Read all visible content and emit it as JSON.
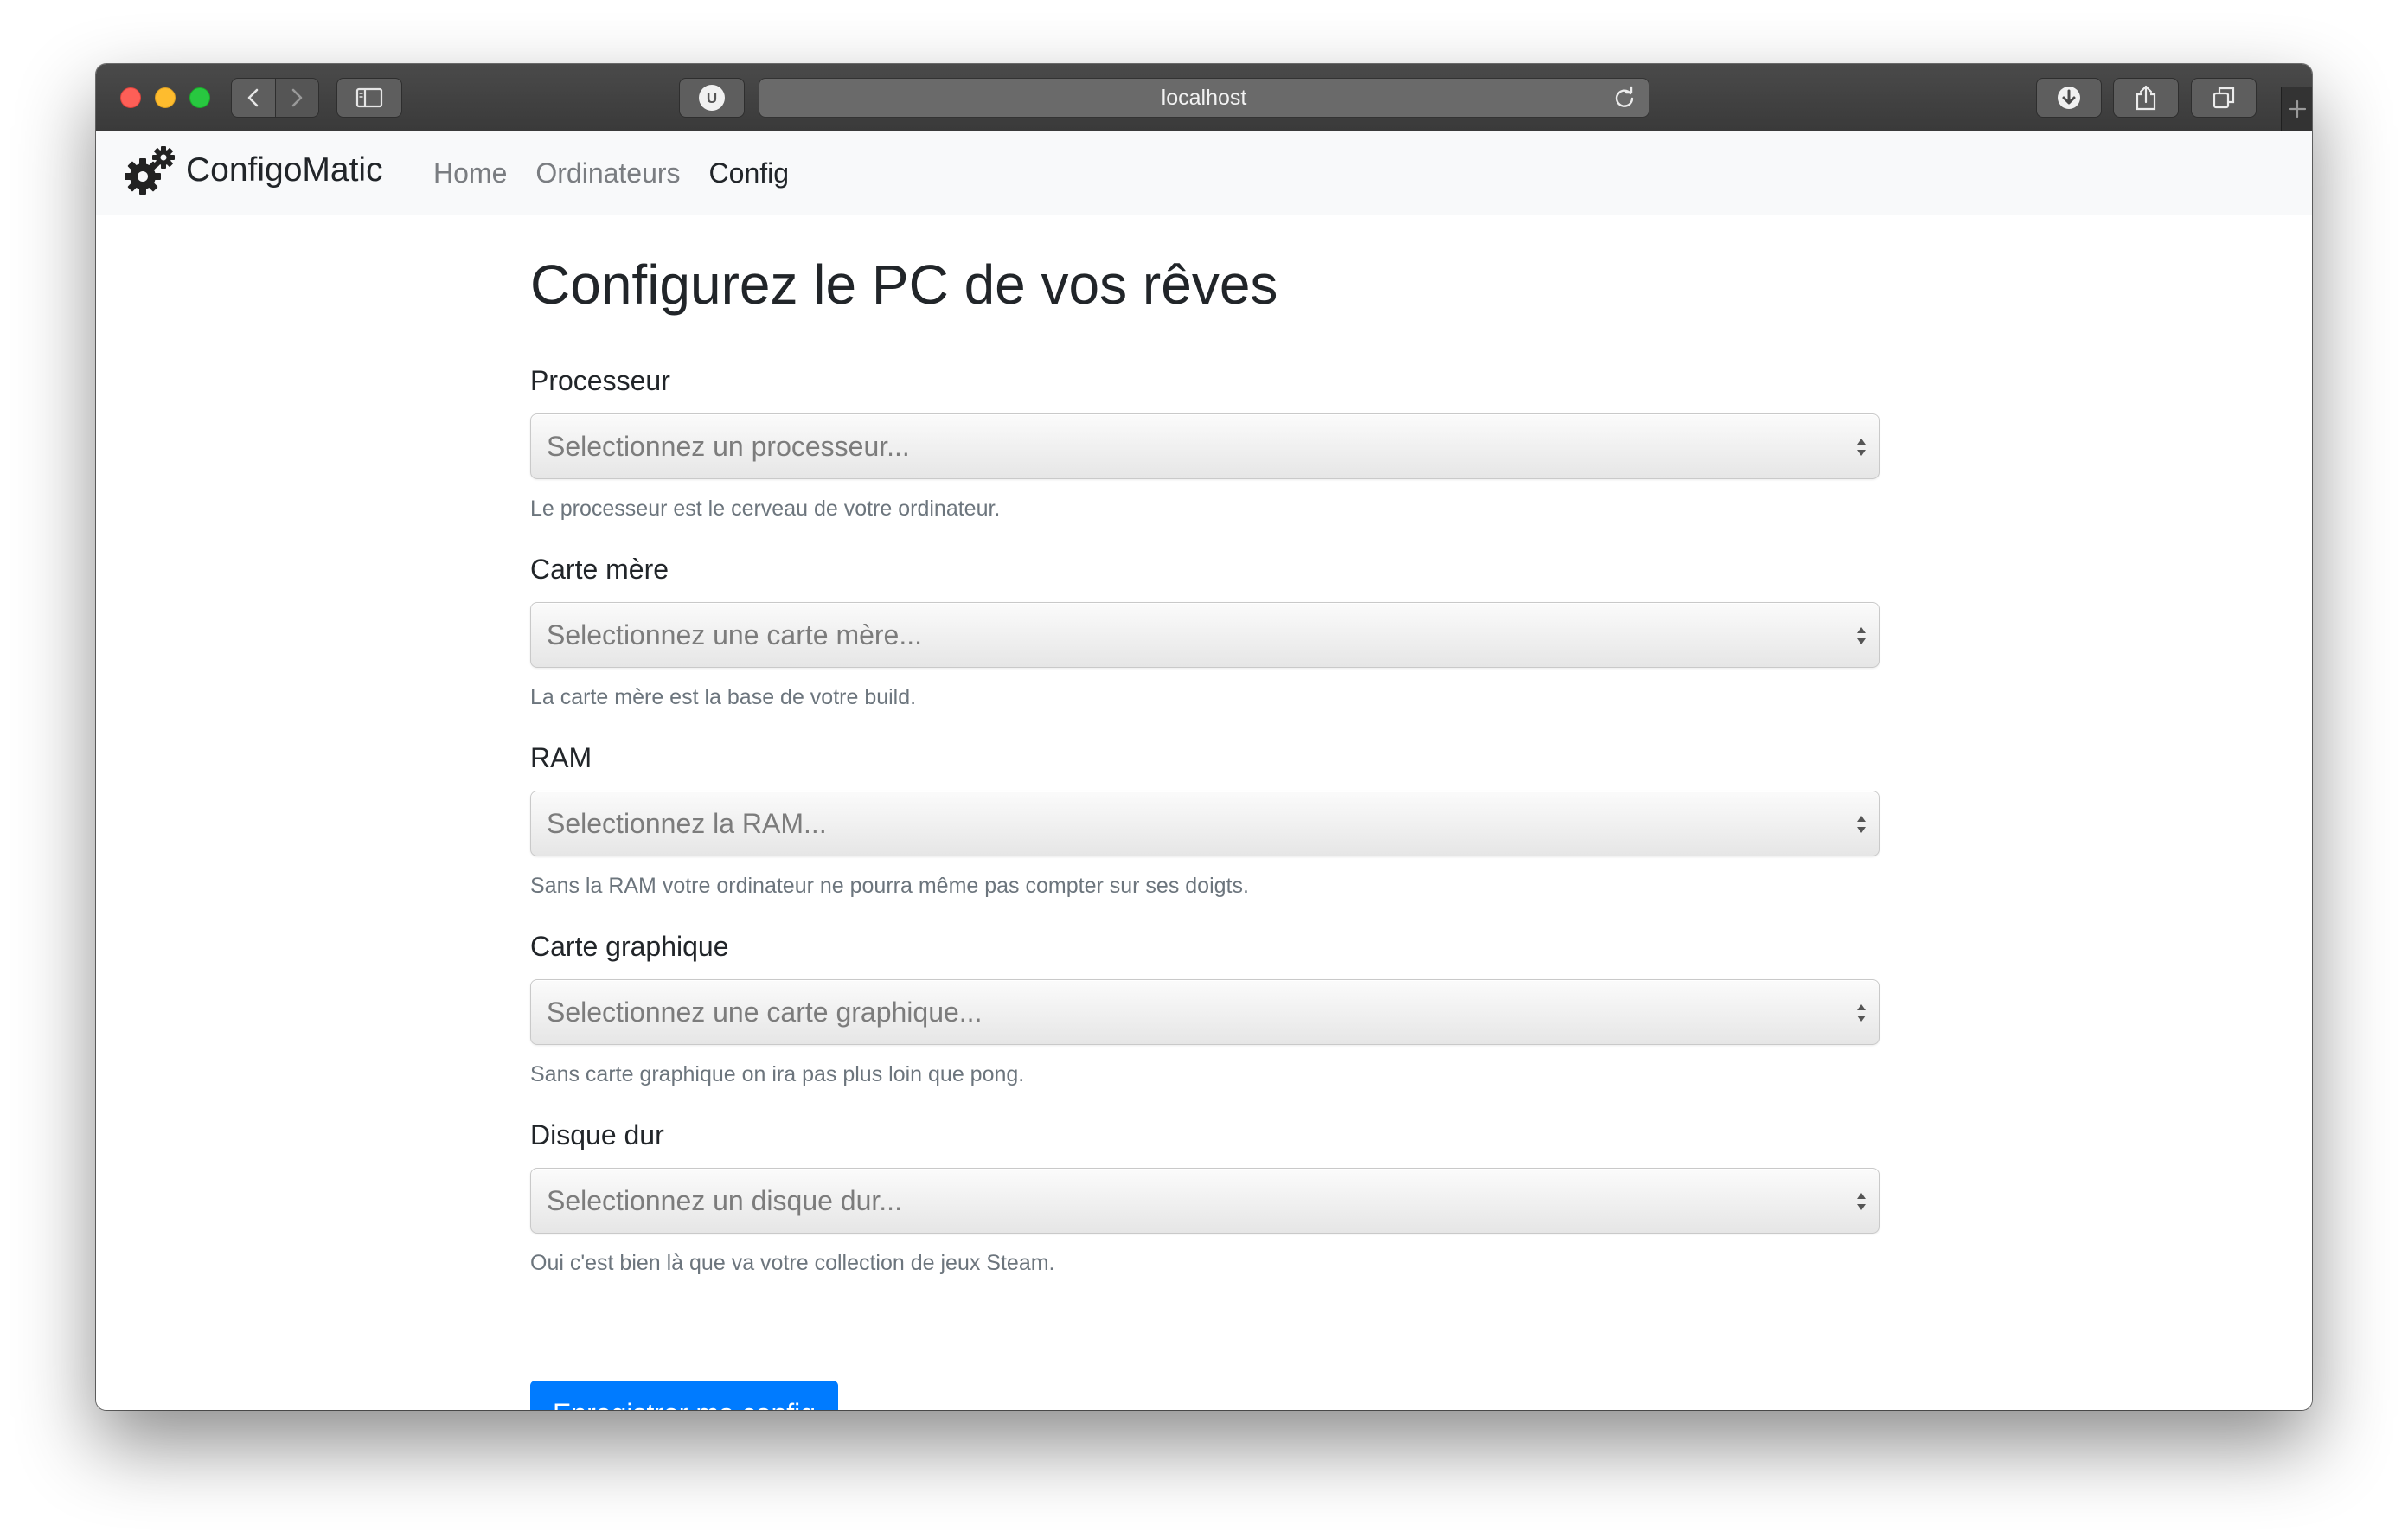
{
  "browser": {
    "url": "localhost",
    "extension_badge": "U",
    "icons": [
      "back-icon",
      "forward-icon",
      "sidebar-icon",
      "reload-icon",
      "download-icon",
      "share-icon",
      "tabs-icon",
      "new-tab-icon"
    ]
  },
  "navbar": {
    "brand": "ConfigoMatic",
    "brand_icon": "gears-icon",
    "links": [
      {
        "label": "Home",
        "active": false
      },
      {
        "label": "Ordinateurs",
        "active": false
      },
      {
        "label": "Config",
        "active": true
      }
    ]
  },
  "main": {
    "title": "Configurez le PC de vos rêves",
    "fields": [
      {
        "label": "Processeur",
        "placeholder": "Selectionnez un processeur...",
        "help": "Le processeur est le cerveau de votre ordinateur."
      },
      {
        "label": "Carte mère",
        "placeholder": "Selectionnez une carte mère...",
        "help": "La carte mère est la base de votre build."
      },
      {
        "label": "RAM",
        "placeholder": "Selectionnez la RAM...",
        "help": "Sans la RAM votre ordinateur ne pourra même pas compter sur ses doigts."
      },
      {
        "label": "Carte graphique",
        "placeholder": "Selectionnez une carte graphique...",
        "help": "Sans carte graphique on ira pas plus loin que pong."
      },
      {
        "label": "Disque dur",
        "placeholder": "Selectionnez un disque dur...",
        "help": "Oui c'est bien là que va votre collection de jeux Steam."
      }
    ],
    "submit_label": "Enregistrer ma config"
  },
  "colors": {
    "primary": "#007bff",
    "navbar_bg": "#f8f9fa",
    "text": "#212529",
    "muted": "#6c757d"
  }
}
